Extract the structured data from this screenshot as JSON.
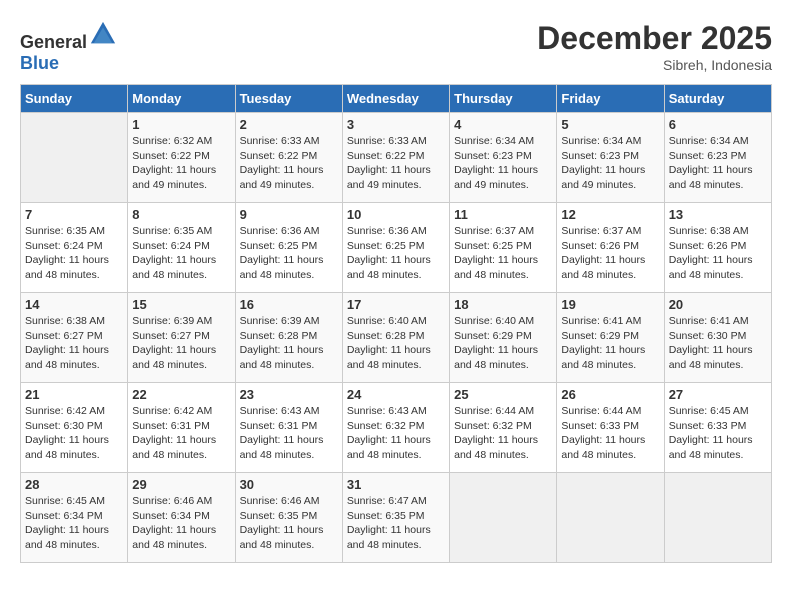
{
  "header": {
    "logo_general": "General",
    "logo_blue": "Blue",
    "month_year": "December 2025",
    "location": "Sibreh, Indonesia"
  },
  "days_of_week": [
    "Sunday",
    "Monday",
    "Tuesday",
    "Wednesday",
    "Thursday",
    "Friday",
    "Saturday"
  ],
  "weeks": [
    [
      {
        "day": "",
        "sunrise": "",
        "sunset": "",
        "daylight": "",
        "empty": true
      },
      {
        "day": "1",
        "sunrise": "Sunrise: 6:32 AM",
        "sunset": "Sunset: 6:22 PM",
        "daylight": "Daylight: 11 hours and 49 minutes."
      },
      {
        "day": "2",
        "sunrise": "Sunrise: 6:33 AM",
        "sunset": "Sunset: 6:22 PM",
        "daylight": "Daylight: 11 hours and 49 minutes."
      },
      {
        "day": "3",
        "sunrise": "Sunrise: 6:33 AM",
        "sunset": "Sunset: 6:22 PM",
        "daylight": "Daylight: 11 hours and 49 minutes."
      },
      {
        "day": "4",
        "sunrise": "Sunrise: 6:34 AM",
        "sunset": "Sunset: 6:23 PM",
        "daylight": "Daylight: 11 hours and 49 minutes."
      },
      {
        "day": "5",
        "sunrise": "Sunrise: 6:34 AM",
        "sunset": "Sunset: 6:23 PM",
        "daylight": "Daylight: 11 hours and 49 minutes."
      },
      {
        "day": "6",
        "sunrise": "Sunrise: 6:34 AM",
        "sunset": "Sunset: 6:23 PM",
        "daylight": "Daylight: 11 hours and 48 minutes."
      }
    ],
    [
      {
        "day": "7",
        "sunrise": "Sunrise: 6:35 AM",
        "sunset": "Sunset: 6:24 PM",
        "daylight": "Daylight: 11 hours and 48 minutes."
      },
      {
        "day": "8",
        "sunrise": "Sunrise: 6:35 AM",
        "sunset": "Sunset: 6:24 PM",
        "daylight": "Daylight: 11 hours and 48 minutes."
      },
      {
        "day": "9",
        "sunrise": "Sunrise: 6:36 AM",
        "sunset": "Sunset: 6:25 PM",
        "daylight": "Daylight: 11 hours and 48 minutes."
      },
      {
        "day": "10",
        "sunrise": "Sunrise: 6:36 AM",
        "sunset": "Sunset: 6:25 PM",
        "daylight": "Daylight: 11 hours and 48 minutes."
      },
      {
        "day": "11",
        "sunrise": "Sunrise: 6:37 AM",
        "sunset": "Sunset: 6:25 PM",
        "daylight": "Daylight: 11 hours and 48 minutes."
      },
      {
        "day": "12",
        "sunrise": "Sunrise: 6:37 AM",
        "sunset": "Sunset: 6:26 PM",
        "daylight": "Daylight: 11 hours and 48 minutes."
      },
      {
        "day": "13",
        "sunrise": "Sunrise: 6:38 AM",
        "sunset": "Sunset: 6:26 PM",
        "daylight": "Daylight: 11 hours and 48 minutes."
      }
    ],
    [
      {
        "day": "14",
        "sunrise": "Sunrise: 6:38 AM",
        "sunset": "Sunset: 6:27 PM",
        "daylight": "Daylight: 11 hours and 48 minutes."
      },
      {
        "day": "15",
        "sunrise": "Sunrise: 6:39 AM",
        "sunset": "Sunset: 6:27 PM",
        "daylight": "Daylight: 11 hours and 48 minutes."
      },
      {
        "day": "16",
        "sunrise": "Sunrise: 6:39 AM",
        "sunset": "Sunset: 6:28 PM",
        "daylight": "Daylight: 11 hours and 48 minutes."
      },
      {
        "day": "17",
        "sunrise": "Sunrise: 6:40 AM",
        "sunset": "Sunset: 6:28 PM",
        "daylight": "Daylight: 11 hours and 48 minutes."
      },
      {
        "day": "18",
        "sunrise": "Sunrise: 6:40 AM",
        "sunset": "Sunset: 6:29 PM",
        "daylight": "Daylight: 11 hours and 48 minutes."
      },
      {
        "day": "19",
        "sunrise": "Sunrise: 6:41 AM",
        "sunset": "Sunset: 6:29 PM",
        "daylight": "Daylight: 11 hours and 48 minutes."
      },
      {
        "day": "20",
        "sunrise": "Sunrise: 6:41 AM",
        "sunset": "Sunset: 6:30 PM",
        "daylight": "Daylight: 11 hours and 48 minutes."
      }
    ],
    [
      {
        "day": "21",
        "sunrise": "Sunrise: 6:42 AM",
        "sunset": "Sunset: 6:30 PM",
        "daylight": "Daylight: 11 hours and 48 minutes."
      },
      {
        "day": "22",
        "sunrise": "Sunrise: 6:42 AM",
        "sunset": "Sunset: 6:31 PM",
        "daylight": "Daylight: 11 hours and 48 minutes."
      },
      {
        "day": "23",
        "sunrise": "Sunrise: 6:43 AM",
        "sunset": "Sunset: 6:31 PM",
        "daylight": "Daylight: 11 hours and 48 minutes."
      },
      {
        "day": "24",
        "sunrise": "Sunrise: 6:43 AM",
        "sunset": "Sunset: 6:32 PM",
        "daylight": "Daylight: 11 hours and 48 minutes."
      },
      {
        "day": "25",
        "sunrise": "Sunrise: 6:44 AM",
        "sunset": "Sunset: 6:32 PM",
        "daylight": "Daylight: 11 hours and 48 minutes."
      },
      {
        "day": "26",
        "sunrise": "Sunrise: 6:44 AM",
        "sunset": "Sunset: 6:33 PM",
        "daylight": "Daylight: 11 hours and 48 minutes."
      },
      {
        "day": "27",
        "sunrise": "Sunrise: 6:45 AM",
        "sunset": "Sunset: 6:33 PM",
        "daylight": "Daylight: 11 hours and 48 minutes."
      }
    ],
    [
      {
        "day": "28",
        "sunrise": "Sunrise: 6:45 AM",
        "sunset": "Sunset: 6:34 PM",
        "daylight": "Daylight: 11 hours and 48 minutes."
      },
      {
        "day": "29",
        "sunrise": "Sunrise: 6:46 AM",
        "sunset": "Sunset: 6:34 PM",
        "daylight": "Daylight: 11 hours and 48 minutes."
      },
      {
        "day": "30",
        "sunrise": "Sunrise: 6:46 AM",
        "sunset": "Sunset: 6:35 PM",
        "daylight": "Daylight: 11 hours and 48 minutes."
      },
      {
        "day": "31",
        "sunrise": "Sunrise: 6:47 AM",
        "sunset": "Sunset: 6:35 PM",
        "daylight": "Daylight: 11 hours and 48 minutes."
      },
      {
        "day": "",
        "sunrise": "",
        "sunset": "",
        "daylight": "",
        "empty": true
      },
      {
        "day": "",
        "sunrise": "",
        "sunset": "",
        "daylight": "",
        "empty": true
      },
      {
        "day": "",
        "sunrise": "",
        "sunset": "",
        "daylight": "",
        "empty": true
      }
    ]
  ]
}
